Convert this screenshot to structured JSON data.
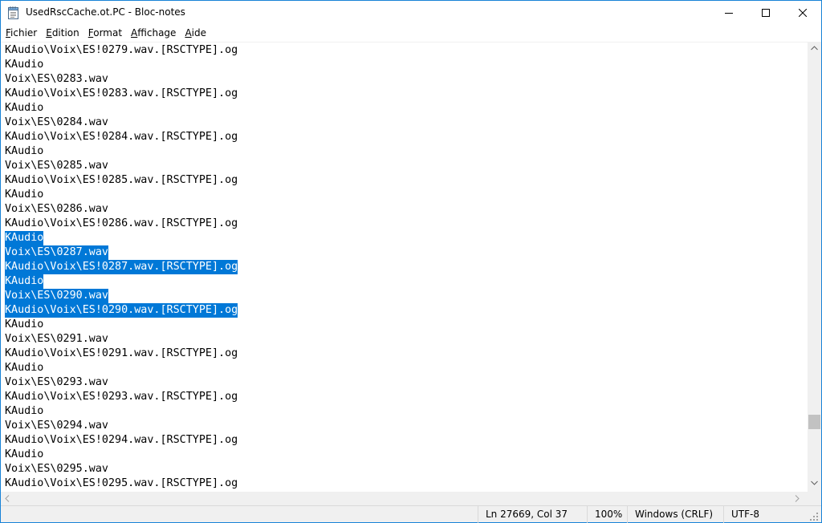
{
  "window": {
    "title": "UsedRscCache.ot.PC - Bloc-notes",
    "controls": {
      "minimize": "minimize",
      "maximize": "maximize",
      "close": "close"
    }
  },
  "menu": [
    {
      "first": "F",
      "rest": "ichier"
    },
    {
      "first": "E",
      "rest": "dition"
    },
    {
      "first": "F",
      "rest": "ormat"
    },
    {
      "first": "A",
      "rest": "ffichage"
    },
    {
      "first": "A",
      "rest": "ide"
    }
  ],
  "editor": {
    "lines": [
      {
        "text": "KAudio\\Voix\\ES!0279.wav.[RSCTYPE].og",
        "selected": false
      },
      {
        "text": "KAudio",
        "selected": false
      },
      {
        "text": "Voix\\ES\\0283.wav",
        "selected": false
      },
      {
        "text": "KAudio\\Voix\\ES!0283.wav.[RSCTYPE].og",
        "selected": false
      },
      {
        "text": "KAudio",
        "selected": false
      },
      {
        "text": "Voix\\ES\\0284.wav",
        "selected": false
      },
      {
        "text": "KAudio\\Voix\\ES!0284.wav.[RSCTYPE].og",
        "selected": false
      },
      {
        "text": "KAudio",
        "selected": false
      },
      {
        "text": "Voix\\ES\\0285.wav",
        "selected": false
      },
      {
        "text": "KAudio\\Voix\\ES!0285.wav.[RSCTYPE].og",
        "selected": false
      },
      {
        "text": "KAudio",
        "selected": false
      },
      {
        "text": "Voix\\ES\\0286.wav",
        "selected": false
      },
      {
        "text": "KAudio\\Voix\\ES!0286.wav.[RSCTYPE].og",
        "selected": false
      },
      {
        "text": "KAudio",
        "selected": true
      },
      {
        "text": "Voix\\ES\\0287.wav",
        "selected": true
      },
      {
        "text": "KAudio\\Voix\\ES!0287.wav.[RSCTYPE].og",
        "selected": true
      },
      {
        "text": "KAudio",
        "selected": true
      },
      {
        "text": "Voix\\ES\\0290.wav",
        "selected": true
      },
      {
        "text": "KAudio\\Voix\\ES!0290.wav.[RSCTYPE].og",
        "selected": true
      },
      {
        "text": "KAudio",
        "selected": false
      },
      {
        "text": "Voix\\ES\\0291.wav",
        "selected": false
      },
      {
        "text": "KAudio\\Voix\\ES!0291.wav.[RSCTYPE].og",
        "selected": false
      },
      {
        "text": "KAudio",
        "selected": false
      },
      {
        "text": "Voix\\ES\\0293.wav",
        "selected": false
      },
      {
        "text": "KAudio\\Voix\\ES!0293.wav.[RSCTYPE].og",
        "selected": false
      },
      {
        "text": "KAudio",
        "selected": false
      },
      {
        "text": "Voix\\ES\\0294.wav",
        "selected": false
      },
      {
        "text": "KAudio\\Voix\\ES!0294.wav.[RSCTYPE].og",
        "selected": false
      },
      {
        "text": "KAudio",
        "selected": false
      },
      {
        "text": "Voix\\ES\\0295.wav",
        "selected": false
      },
      {
        "text": "KAudio\\Voix\\ES!0295.wav.[RSCTYPE].og",
        "selected": false
      }
    ],
    "selection_color": "#0078d7"
  },
  "status": {
    "position": "Ln 27669, Col 37",
    "zoom": "100%",
    "line_ending": "Windows (CRLF)",
    "encoding": "UTF-8"
  },
  "colors": {
    "window_border": "#1883d7",
    "chrome": "#f0f0f0"
  }
}
